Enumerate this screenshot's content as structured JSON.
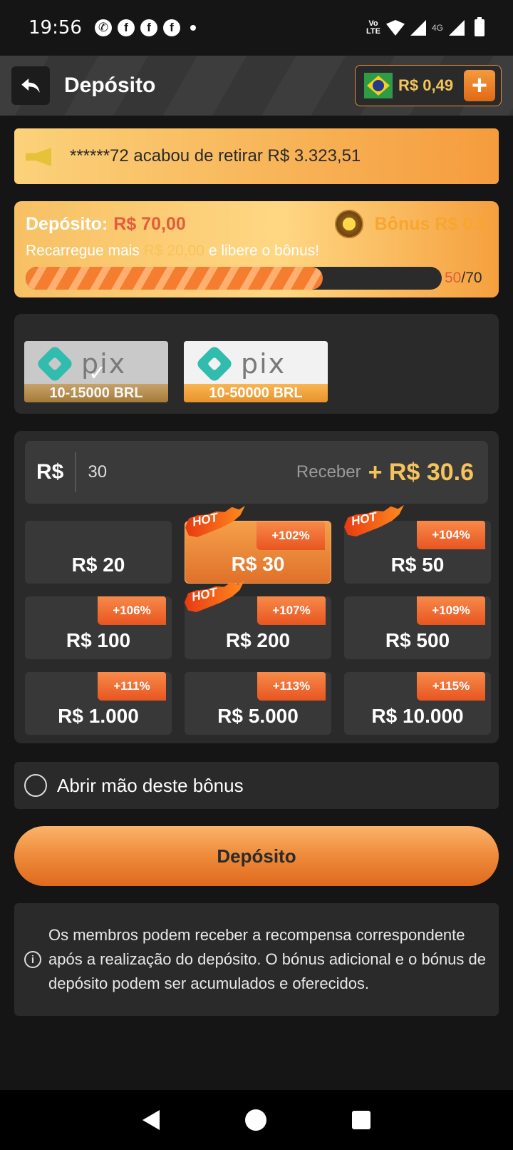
{
  "status_bar": {
    "time": "19:56",
    "network": "LTE",
    "network_badge": "4G"
  },
  "header": {
    "title": "Depósito",
    "balance": "R$ 0,49",
    "add_label": "+"
  },
  "marquee": {
    "text": "******72 acabou de retirar R$ 3.323,51"
  },
  "deposit_progress": {
    "label": "Depósito:",
    "amount": "R$ 70,00",
    "bonus": "Bônus R$ 0.5",
    "hint_prefix": "Recarregue mais",
    "hint_amount": "R$ 20,00",
    "hint_suffix": "e libere o bônus!",
    "current": "50",
    "total": "/70",
    "progress_fraction": 0.714
  },
  "payment_methods": [
    {
      "name": "pix",
      "range": "10-15000 BRL",
      "selected": true
    },
    {
      "name": "pix",
      "range": "10-50000 BRL",
      "selected": false
    }
  ],
  "amount_input": {
    "currency": "R$",
    "value": "30",
    "receive_label": "Receber",
    "receive_value": "+ R$ 30.6"
  },
  "amount_options": [
    {
      "amount": "R$ 20",
      "bonus": "",
      "hot": false,
      "active": false
    },
    {
      "amount": "R$ 30",
      "bonus": "+102%",
      "hot": true,
      "active": true
    },
    {
      "amount": "R$ 50",
      "bonus": "+104%",
      "hot": true,
      "active": false
    },
    {
      "amount": "R$ 100",
      "bonus": "+106%",
      "hot": false,
      "active": false
    },
    {
      "amount": "R$ 200",
      "bonus": "+107%",
      "hot": true,
      "active": false
    },
    {
      "amount": "R$ 500",
      "bonus": "+109%",
      "hot": false,
      "active": false
    },
    {
      "amount": "R$ 1.000",
      "bonus": "+111%",
      "hot": false,
      "active": false
    },
    {
      "amount": "R$ 5.000",
      "bonus": "+113%",
      "hot": false,
      "active": false
    },
    {
      "amount": "R$ 10.000",
      "bonus": "+115%",
      "hot": false,
      "active": false
    }
  ],
  "hot_label": "HOT",
  "forfeit": {
    "label": "Abrir mão deste bônus"
  },
  "deposit_button": {
    "label": "Depósito"
  },
  "info": {
    "icon": "i",
    "text": "Os membros podem receber a recompensa correspondente após a realização do depósito. O bónus adicional e o bónus de depósito podem ser acumulados e oferecidos."
  },
  "colors": {
    "accent": "#ee8a3a",
    "gold": "#f5c35b",
    "red": "#e35d3b",
    "panel": "#2a2a2a"
  }
}
